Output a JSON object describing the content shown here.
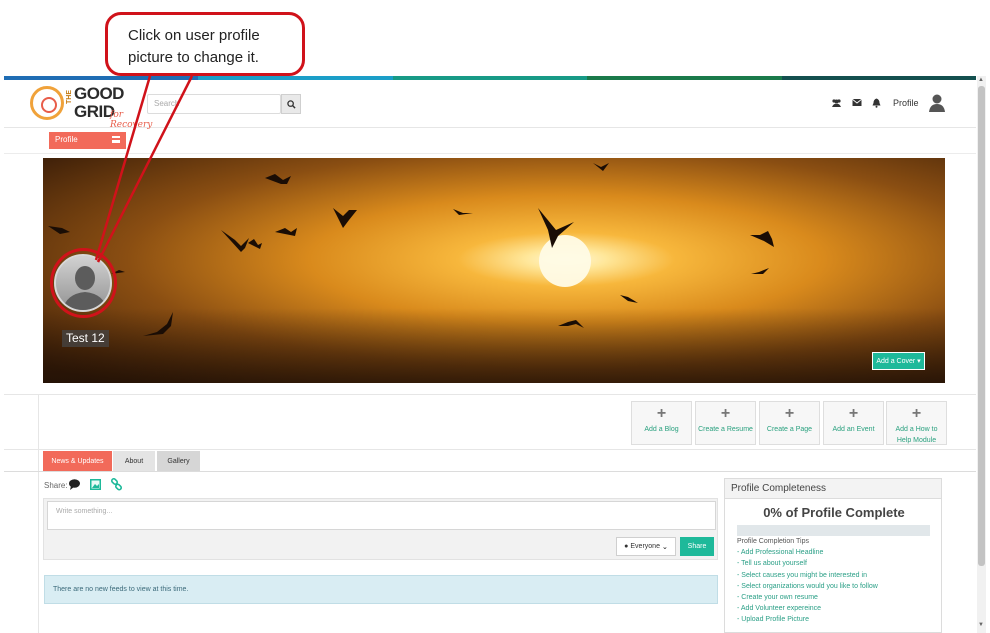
{
  "callout": {
    "line1": "Click  on  user  profile",
    "line2": "picture to change it."
  },
  "topbar_colors": [
    "#1f6db4",
    "#1b9ec8",
    "#179a86",
    "#1a7a4a",
    "#14504f"
  ],
  "header": {
    "logo": {
      "the": "THE",
      "good": "GOOD",
      "grid": "GRID",
      "tagline": "for Recovery"
    },
    "search_placeholder": "Search",
    "icons": [
      "users-icon",
      "mail-icon",
      "bell-icon"
    ],
    "profile_label": "Profile"
  },
  "subnav": {
    "profile_tab": "Profile"
  },
  "cover": {
    "username": "Test 12",
    "add_cover_label": "Add a Cover ▾"
  },
  "actions": [
    {
      "icon": "plus-icon",
      "label": "Add a Blog"
    },
    {
      "icon": "plus-icon",
      "label": "Create a Resume"
    },
    {
      "icon": "plus-icon",
      "label": "Create a Page"
    },
    {
      "icon": "plus-icon",
      "label": "Add an Event"
    },
    {
      "icon": "plus-icon",
      "label": "Add a How to Help Module"
    }
  ],
  "tabs": [
    "News & Updates",
    "About",
    "Gallery"
  ],
  "feed": {
    "share_label": "Share:",
    "composer_placeholder": "Write something...",
    "privacy_label": "Everyone",
    "share_button": "Share",
    "empty_message": "There are no new feeds to view at this time."
  },
  "profile_completeness": {
    "title": "Profile Completeness",
    "percent_text": "0% of Profile Complete",
    "percent_value": 0,
    "tips_title": "Profile Completion Tips",
    "tips": [
      "- Add Professional Headline",
      "- Tell us about yourself",
      "- Select causes you might be interested in",
      "- Select organizations would you like to follow",
      "- Create your own resume",
      "- Add Volunteer expereince",
      "- Upload Profile Picture"
    ]
  },
  "colors": {
    "accent_red": "#f26a5a",
    "accent_teal": "#1eb99a",
    "callout_red": "#d0121a"
  }
}
